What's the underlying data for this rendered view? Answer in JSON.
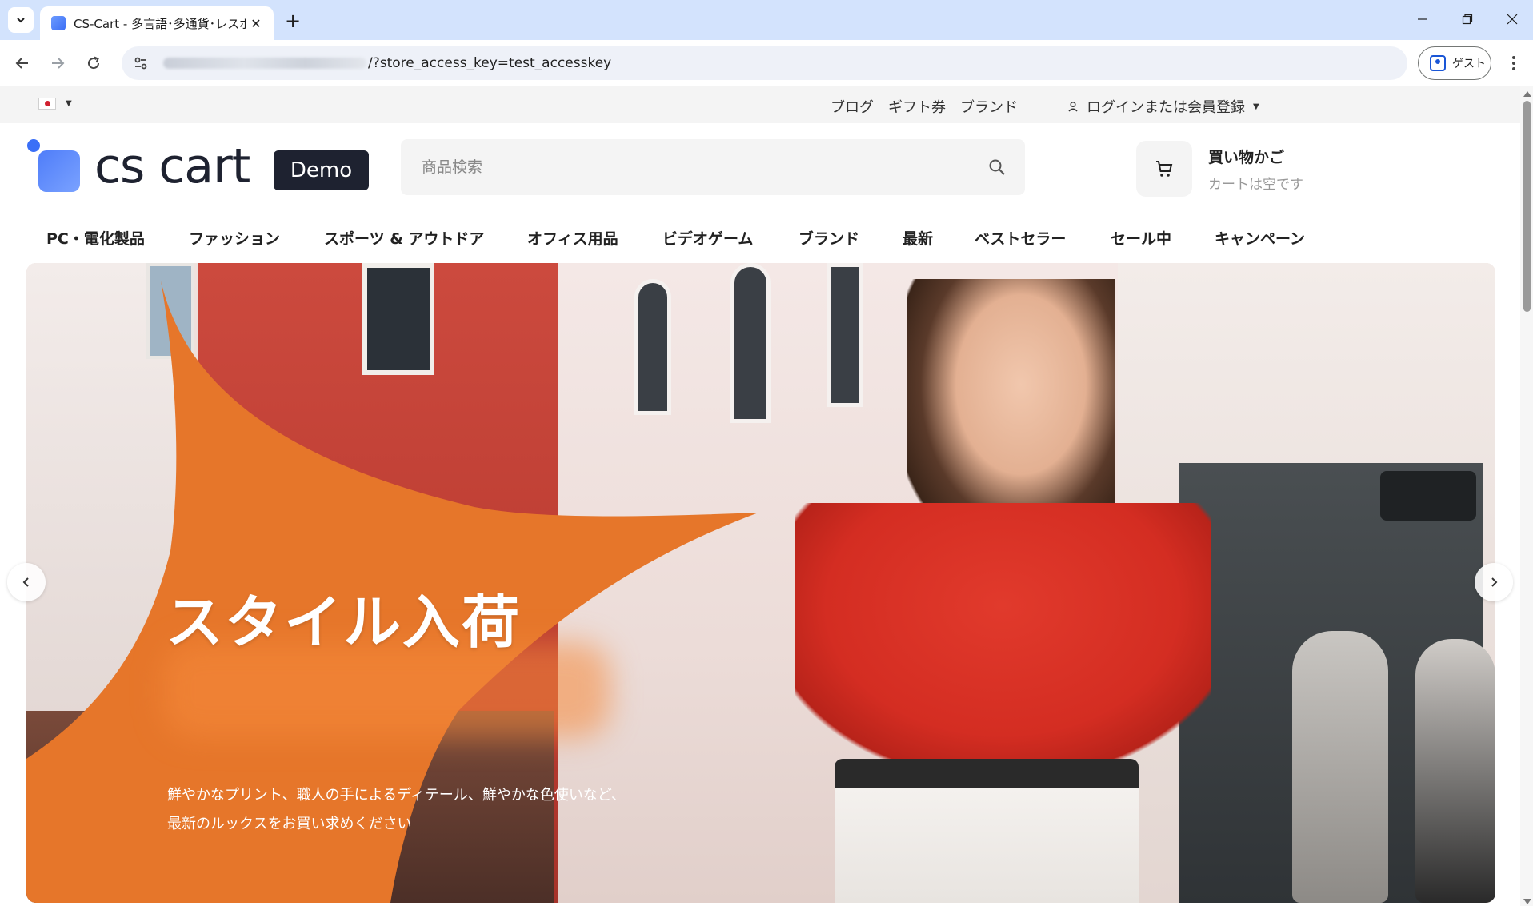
{
  "browser": {
    "tab_title": "CS-Cart - 多言語･多通貨･レスポ",
    "url_visible": "/?store_access_key=test_accesskey",
    "profile_label": "ゲスト"
  },
  "topbar": {
    "links": [
      "ブログ",
      "ギフト券",
      "ブランド"
    ],
    "login_label": "ログインまたは会員登録"
  },
  "header": {
    "logo_text": "cs cart",
    "badge": "Demo",
    "search_placeholder": "商品検索",
    "cart_title": "買い物かご",
    "cart_status": "カートは空です"
  },
  "menu": [
    "PC・電化製品",
    "ファッション",
    "スポーツ & アウトドア",
    "オフィス用品",
    "ビデオゲーム",
    "ブランド",
    "最新",
    "ベストセラー",
    "セール中",
    "キャンペーン"
  ],
  "hero": {
    "title": "スタイル入荷",
    "desc_line1": "鮮やかなプリント、職人の手によるディテール、鮮やかな色使いなど、",
    "desc_line2": "最新のルックスをお買い求めください"
  },
  "colors": {
    "accent_orange": "#e6762a",
    "brand_blue": "#3a6ff7",
    "dark": "#1e2230"
  }
}
